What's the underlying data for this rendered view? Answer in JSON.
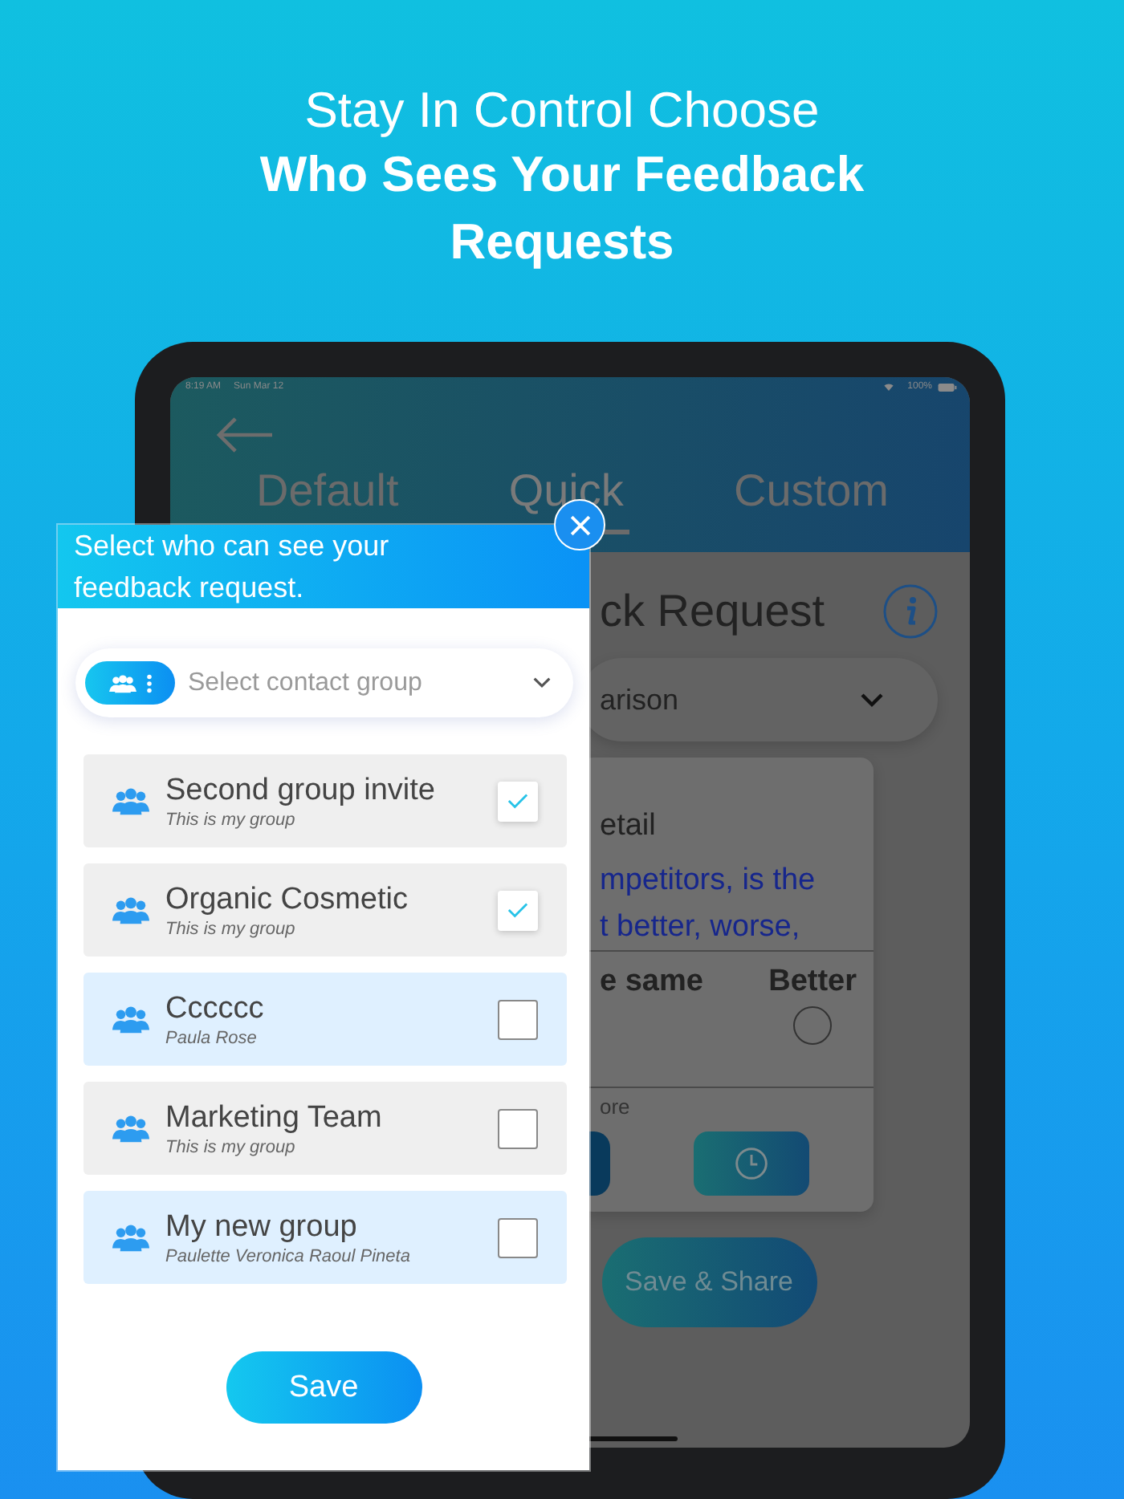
{
  "headline": {
    "intro": "Stay In Control Choose",
    "emphasis": "Who Sees Your Feedback Requests"
  },
  "device_screen": {
    "status_bar": {
      "time": "8:19 AM",
      "date": "Sun Mar 12",
      "battery": "100%"
    },
    "tabs": [
      {
        "label": "Default",
        "selected": false
      },
      {
        "label": "Quick",
        "selected": true
      },
      {
        "label": "Custom",
        "selected": false
      }
    ],
    "title": "ck Request",
    "dropdown": {
      "value": "arison"
    },
    "card": {
      "heading": "etail",
      "question": [
        "mpetitors, is the",
        "t better, worse,"
      ],
      "options": [
        {
          "label": "e same"
        },
        {
          "label": "Better",
          "selected": false
        }
      ],
      "note": "ore"
    },
    "save_share_button": "Save & Share"
  },
  "dialog": {
    "title": "Select who can see your feedback request.",
    "select": {
      "placeholder": "Select contact group"
    },
    "groups": [
      {
        "name": "Second group invite",
        "subtitle": "This is my group",
        "checked": true,
        "highlighted": false
      },
      {
        "name": "Organic Cosmetic",
        "subtitle": "This is my group",
        "checked": true,
        "highlighted": false
      },
      {
        "name": "Cccccc",
        "subtitle": "Paula Rose",
        "checked": false,
        "highlighted": true
      },
      {
        "name": "Marketing Team",
        "subtitle": "This is my group",
        "checked": false,
        "highlighted": false
      },
      {
        "name": "My new group",
        "subtitle": "Paulette Veronica  Raoul Pineta",
        "checked": false,
        "highlighted": true
      }
    ],
    "save_button": "Save"
  }
}
